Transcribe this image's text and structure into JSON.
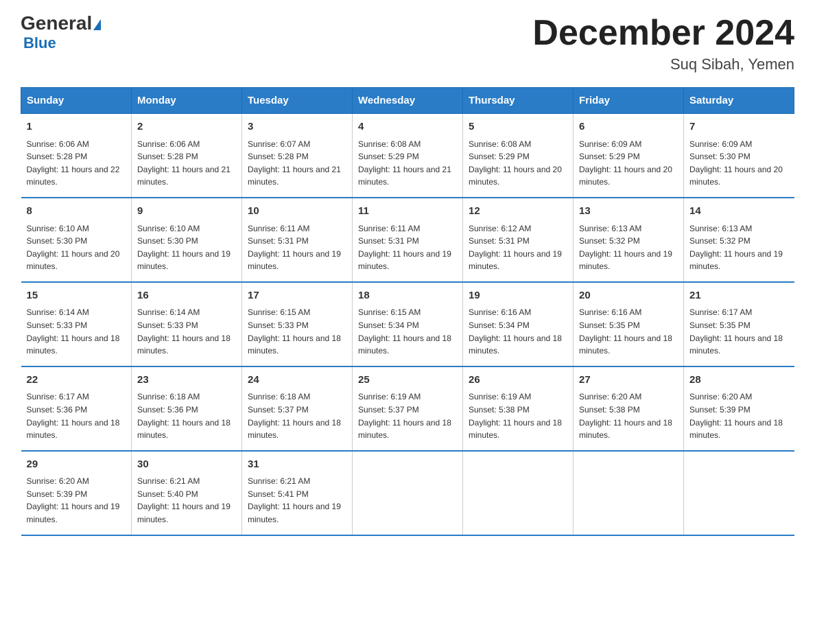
{
  "header": {
    "logo_main": "General",
    "logo_sub": "Blue",
    "month_title": "December 2024",
    "location": "Suq Sibah, Yemen"
  },
  "days_of_week": [
    "Sunday",
    "Monday",
    "Tuesday",
    "Wednesday",
    "Thursday",
    "Friday",
    "Saturday"
  ],
  "weeks": [
    [
      {
        "day": "1",
        "sunrise": "6:06 AM",
        "sunset": "5:28 PM",
        "daylight": "11 hours and 22 minutes."
      },
      {
        "day": "2",
        "sunrise": "6:06 AM",
        "sunset": "5:28 PM",
        "daylight": "11 hours and 21 minutes."
      },
      {
        "day": "3",
        "sunrise": "6:07 AM",
        "sunset": "5:28 PM",
        "daylight": "11 hours and 21 minutes."
      },
      {
        "day": "4",
        "sunrise": "6:08 AM",
        "sunset": "5:29 PM",
        "daylight": "11 hours and 21 minutes."
      },
      {
        "day": "5",
        "sunrise": "6:08 AM",
        "sunset": "5:29 PM",
        "daylight": "11 hours and 20 minutes."
      },
      {
        "day": "6",
        "sunrise": "6:09 AM",
        "sunset": "5:29 PM",
        "daylight": "11 hours and 20 minutes."
      },
      {
        "day": "7",
        "sunrise": "6:09 AM",
        "sunset": "5:30 PM",
        "daylight": "11 hours and 20 minutes."
      }
    ],
    [
      {
        "day": "8",
        "sunrise": "6:10 AM",
        "sunset": "5:30 PM",
        "daylight": "11 hours and 20 minutes."
      },
      {
        "day": "9",
        "sunrise": "6:10 AM",
        "sunset": "5:30 PM",
        "daylight": "11 hours and 19 minutes."
      },
      {
        "day": "10",
        "sunrise": "6:11 AM",
        "sunset": "5:31 PM",
        "daylight": "11 hours and 19 minutes."
      },
      {
        "day": "11",
        "sunrise": "6:11 AM",
        "sunset": "5:31 PM",
        "daylight": "11 hours and 19 minutes."
      },
      {
        "day": "12",
        "sunrise": "6:12 AM",
        "sunset": "5:31 PM",
        "daylight": "11 hours and 19 minutes."
      },
      {
        "day": "13",
        "sunrise": "6:13 AM",
        "sunset": "5:32 PM",
        "daylight": "11 hours and 19 minutes."
      },
      {
        "day": "14",
        "sunrise": "6:13 AM",
        "sunset": "5:32 PM",
        "daylight": "11 hours and 19 minutes."
      }
    ],
    [
      {
        "day": "15",
        "sunrise": "6:14 AM",
        "sunset": "5:33 PM",
        "daylight": "11 hours and 18 minutes."
      },
      {
        "day": "16",
        "sunrise": "6:14 AM",
        "sunset": "5:33 PM",
        "daylight": "11 hours and 18 minutes."
      },
      {
        "day": "17",
        "sunrise": "6:15 AM",
        "sunset": "5:33 PM",
        "daylight": "11 hours and 18 minutes."
      },
      {
        "day": "18",
        "sunrise": "6:15 AM",
        "sunset": "5:34 PM",
        "daylight": "11 hours and 18 minutes."
      },
      {
        "day": "19",
        "sunrise": "6:16 AM",
        "sunset": "5:34 PM",
        "daylight": "11 hours and 18 minutes."
      },
      {
        "day": "20",
        "sunrise": "6:16 AM",
        "sunset": "5:35 PM",
        "daylight": "11 hours and 18 minutes."
      },
      {
        "day": "21",
        "sunrise": "6:17 AM",
        "sunset": "5:35 PM",
        "daylight": "11 hours and 18 minutes."
      }
    ],
    [
      {
        "day": "22",
        "sunrise": "6:17 AM",
        "sunset": "5:36 PM",
        "daylight": "11 hours and 18 minutes."
      },
      {
        "day": "23",
        "sunrise": "6:18 AM",
        "sunset": "5:36 PM",
        "daylight": "11 hours and 18 minutes."
      },
      {
        "day": "24",
        "sunrise": "6:18 AM",
        "sunset": "5:37 PM",
        "daylight": "11 hours and 18 minutes."
      },
      {
        "day": "25",
        "sunrise": "6:19 AM",
        "sunset": "5:37 PM",
        "daylight": "11 hours and 18 minutes."
      },
      {
        "day": "26",
        "sunrise": "6:19 AM",
        "sunset": "5:38 PM",
        "daylight": "11 hours and 18 minutes."
      },
      {
        "day": "27",
        "sunrise": "6:20 AM",
        "sunset": "5:38 PM",
        "daylight": "11 hours and 18 minutes."
      },
      {
        "day": "28",
        "sunrise": "6:20 AM",
        "sunset": "5:39 PM",
        "daylight": "11 hours and 18 minutes."
      }
    ],
    [
      {
        "day": "29",
        "sunrise": "6:20 AM",
        "sunset": "5:39 PM",
        "daylight": "11 hours and 19 minutes."
      },
      {
        "day": "30",
        "sunrise": "6:21 AM",
        "sunset": "5:40 PM",
        "daylight": "11 hours and 19 minutes."
      },
      {
        "day": "31",
        "sunrise": "6:21 AM",
        "sunset": "5:41 PM",
        "daylight": "11 hours and 19 minutes."
      },
      {
        "day": "",
        "sunrise": "",
        "sunset": "",
        "daylight": ""
      },
      {
        "day": "",
        "sunrise": "",
        "sunset": "",
        "daylight": ""
      },
      {
        "day": "",
        "sunrise": "",
        "sunset": "",
        "daylight": ""
      },
      {
        "day": "",
        "sunrise": "",
        "sunset": "",
        "daylight": ""
      }
    ]
  ],
  "labels": {
    "sunrise_prefix": "Sunrise: ",
    "sunset_prefix": "Sunset: ",
    "daylight_prefix": "Daylight: "
  }
}
